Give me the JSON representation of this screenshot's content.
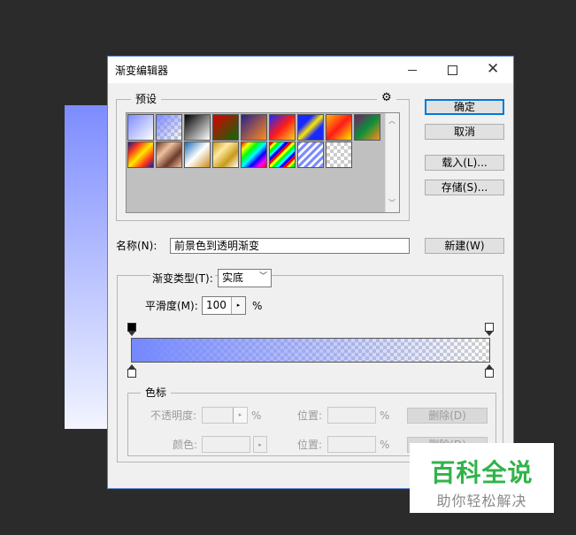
{
  "window": {
    "title": "渐变编辑器",
    "close_glyph": "✕"
  },
  "presets": {
    "label": "预设",
    "gear_glyph": "⚙",
    "swatches_count": 16
  },
  "buttons": {
    "ok": "确定",
    "cancel": "取消",
    "load": "载入(L)...",
    "save": "存储(S)...",
    "new": "新建(W)"
  },
  "name": {
    "label": "名称(N):",
    "value": "前景色到透明渐变"
  },
  "gradient": {
    "type_label": "渐变类型(T):",
    "type_value": "实底",
    "smoothness_label": "平滑度(M):",
    "smoothness_value": "100",
    "smoothness_unit": "%",
    "stop_arrow_glyph": "▸",
    "start_color": "#7488ff"
  },
  "color_stops": {
    "label": "色标",
    "opacity_label": "不透明度:",
    "opacity_unit": "%",
    "color_label": "颜色:",
    "location_label": "位置:",
    "location_unit": "%",
    "delete_label": "删除(D)"
  },
  "watermark": {
    "main": "百科全说",
    "sub": "助你轻松解决"
  }
}
